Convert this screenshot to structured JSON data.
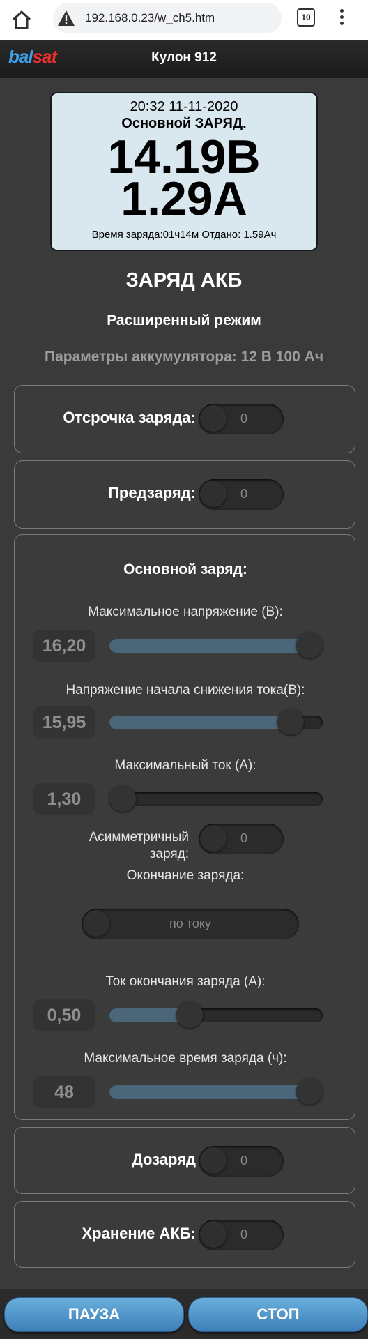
{
  "browser": {
    "url": "192.168.0.23/w_ch5.htm",
    "tab_count": "10"
  },
  "header": {
    "logo_part1": "bal",
    "logo_part2": "sat",
    "title": "Кулон 912"
  },
  "lcd": {
    "datetime": "20:32 11-11-2020",
    "mode": "Основной ЗАРЯД.",
    "voltage": "14.19В",
    "current": "1.29А",
    "footer": "Время заряда:01ч14м Отдано: 1.59Ач"
  },
  "page": {
    "title": "ЗАРЯД АКБ",
    "mode": "Расширенный режим",
    "battery_params": "Параметры аккумулятора: 12 В 100 Ач"
  },
  "delay": {
    "label": "Отсрочка заряда:",
    "toggle_value": "0"
  },
  "precharge": {
    "label": "Предзаряд:",
    "toggle_value": "0"
  },
  "main_charge": {
    "heading": "Основной заряд:",
    "max_voltage": {
      "label": "Максимальное напряжение (В):",
      "value": "16,20",
      "fraction": 1.0
    },
    "decline_voltage": {
      "label": "Напряжение начала снижения тока(В):",
      "value": "15,95",
      "fraction": 0.9
    },
    "max_current": {
      "label": "Максимальный ток (А):",
      "value": "1,30",
      "fraction": 0.0
    },
    "asymmetric": {
      "label_line1": "Асимметричный",
      "label_line2": "заряд:",
      "toggle_value": "0"
    },
    "charge_end": {
      "label": "Окончание заряда:",
      "option": "по току"
    },
    "end_current": {
      "label": "Ток окончания заряда (А):",
      "value": "0,50",
      "fraction": 0.36
    },
    "max_time": {
      "label": "Максимальное время заряда (ч):",
      "value": "48",
      "fraction": 1.0
    }
  },
  "topup": {
    "label": "Дозаряд",
    "toggle_value": "0"
  },
  "storage": {
    "label": "Хранение АКБ:",
    "toggle_value": "0"
  },
  "buttons": {
    "pause": "ПАУЗА",
    "stop": "СТОП"
  },
  "colors": {
    "accent_blue": "#4b6679",
    "button_blue": "#4f92c9",
    "lcd_bg": "#d9e8ee"
  }
}
